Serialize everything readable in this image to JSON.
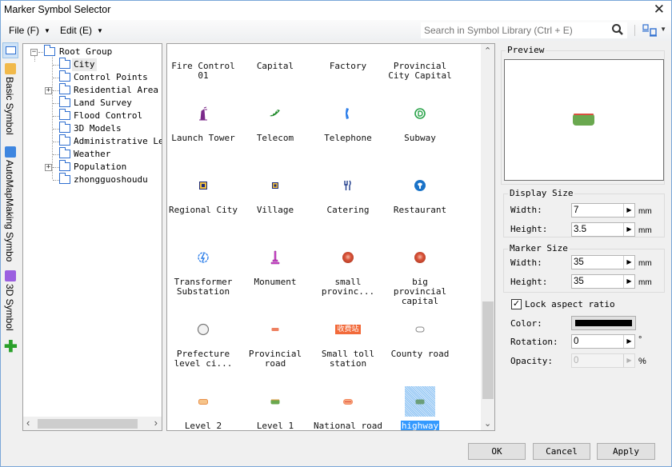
{
  "window": {
    "title": "Marker Symbol Selector",
    "close_glyph": "✕"
  },
  "menu": [
    {
      "label": "File (F)",
      "arrow": "▼"
    },
    {
      "label": "Edit (E)",
      "arrow": "▼"
    }
  ],
  "search": {
    "placeholder": "Search in Symbol Library (Ctrl + E)",
    "value": ""
  },
  "library_tabs": [
    {
      "label": "Basic Symbol",
      "icon": "basic-symbol-icon",
      "color": "#f1b94a"
    },
    {
      "label": "AutoMapMaking Symbo",
      "icon": "automapmaking-icon",
      "color": "#3e86e0"
    },
    {
      "label": "3D Symbol",
      "icon": "3d-symbol-icon",
      "color": "#9b5fe0"
    }
  ],
  "tree": {
    "root": "Root Group",
    "items": [
      {
        "label": "City",
        "expandable": false,
        "selected": true
      },
      {
        "label": "Control Points",
        "expandable": false
      },
      {
        "label": "Residential Area",
        "expandable": true
      },
      {
        "label": "Land Survey",
        "expandable": false
      },
      {
        "label": "Flood Control",
        "expandable": false
      },
      {
        "label": "3D Models",
        "expandable": false
      },
      {
        "label": "Administrative Lev",
        "expandable": false
      },
      {
        "label": "Weather",
        "expandable": false
      },
      {
        "label": "Population",
        "expandable": true
      },
      {
        "label": "zhongguoshoudu",
        "expandable": false
      }
    ]
  },
  "symbols": [
    {
      "name": "Fire Control\n01",
      "icon": "none"
    },
    {
      "name": "Capital",
      "icon": "none"
    },
    {
      "name": "Factory",
      "icon": "none"
    },
    {
      "name": "Provincial\nCity Capital",
      "icon": "none"
    },
    {
      "name": "Launch Tower",
      "icon": "launch-tower-icon"
    },
    {
      "name": "Telecom",
      "icon": "telecom-icon"
    },
    {
      "name": "Telephone",
      "icon": "telephone-icon"
    },
    {
      "name": "Subway",
      "icon": "subway-icon"
    },
    {
      "name": "Regional City",
      "icon": "regional-city-icon"
    },
    {
      "name": "Village",
      "icon": "village-icon"
    },
    {
      "name": "Catering",
      "icon": "catering-icon"
    },
    {
      "name": "Restaurant",
      "icon": "restaurant-icon"
    },
    {
      "name": "Transformer\nSubstation",
      "icon": "transformer-icon"
    },
    {
      "name": "Monument",
      "icon": "monument-icon"
    },
    {
      "name": "small\nprovinc...",
      "icon": "small-provincial-icon"
    },
    {
      "name": "big provincial\ncapital",
      "icon": "big-provincial-icon"
    },
    {
      "name": "Prefecture\nlevel ci...",
      "icon": "prefecture-icon"
    },
    {
      "name": "Provincial\nroad",
      "icon": "provincial-road-icon"
    },
    {
      "name": "Small toll\nstation",
      "icon": "toll-station-icon",
      "badge_text": "收费站"
    },
    {
      "name": "County road",
      "icon": "county-road-icon"
    },
    {
      "name": "Level 2",
      "icon": "level-2-icon"
    },
    {
      "name": "Level 1",
      "icon": "level-1-icon"
    },
    {
      "name": "National road",
      "icon": "national-road-icon"
    },
    {
      "name": "highway",
      "icon": "highway-icon",
      "selected": true
    }
  ],
  "preview": {
    "title": "Preview",
    "symbol_colors": {
      "fill": "#6aa84f",
      "top": "#d9503f"
    }
  },
  "display_size": {
    "title": "Display Size",
    "width_label": "Width:",
    "width_value": "7",
    "width_unit": "mm",
    "height_label": "Height:",
    "height_value": "3.5",
    "height_unit": "mm"
  },
  "marker_size": {
    "title": "Marker Size",
    "width_label": "Width:",
    "width_value": "35",
    "width_unit": "mm",
    "height_label": "Height:",
    "height_value": "35",
    "height_unit": "mm"
  },
  "lock_aspect": {
    "label": "Lock aspect ratio",
    "checked": true,
    "check_glyph": "✓"
  },
  "color": {
    "label": "Color:",
    "value": "#000000"
  },
  "rotation": {
    "label": "Rotation:",
    "value": "0",
    "unit": "°"
  },
  "opacity": {
    "label": "Opacity:",
    "value": "0",
    "unit": "%",
    "disabled": true
  },
  "buttons": {
    "ok": "OK",
    "cancel": "Cancel",
    "apply": "Apply"
  },
  "glyphs": {
    "spin_arrow": "▶",
    "scroll_up": "⌃",
    "scroll_down": "⌄",
    "scroll_left": "‹",
    "scroll_right": "›",
    "expand": "+",
    "collapse": "−",
    "add": "✚"
  }
}
